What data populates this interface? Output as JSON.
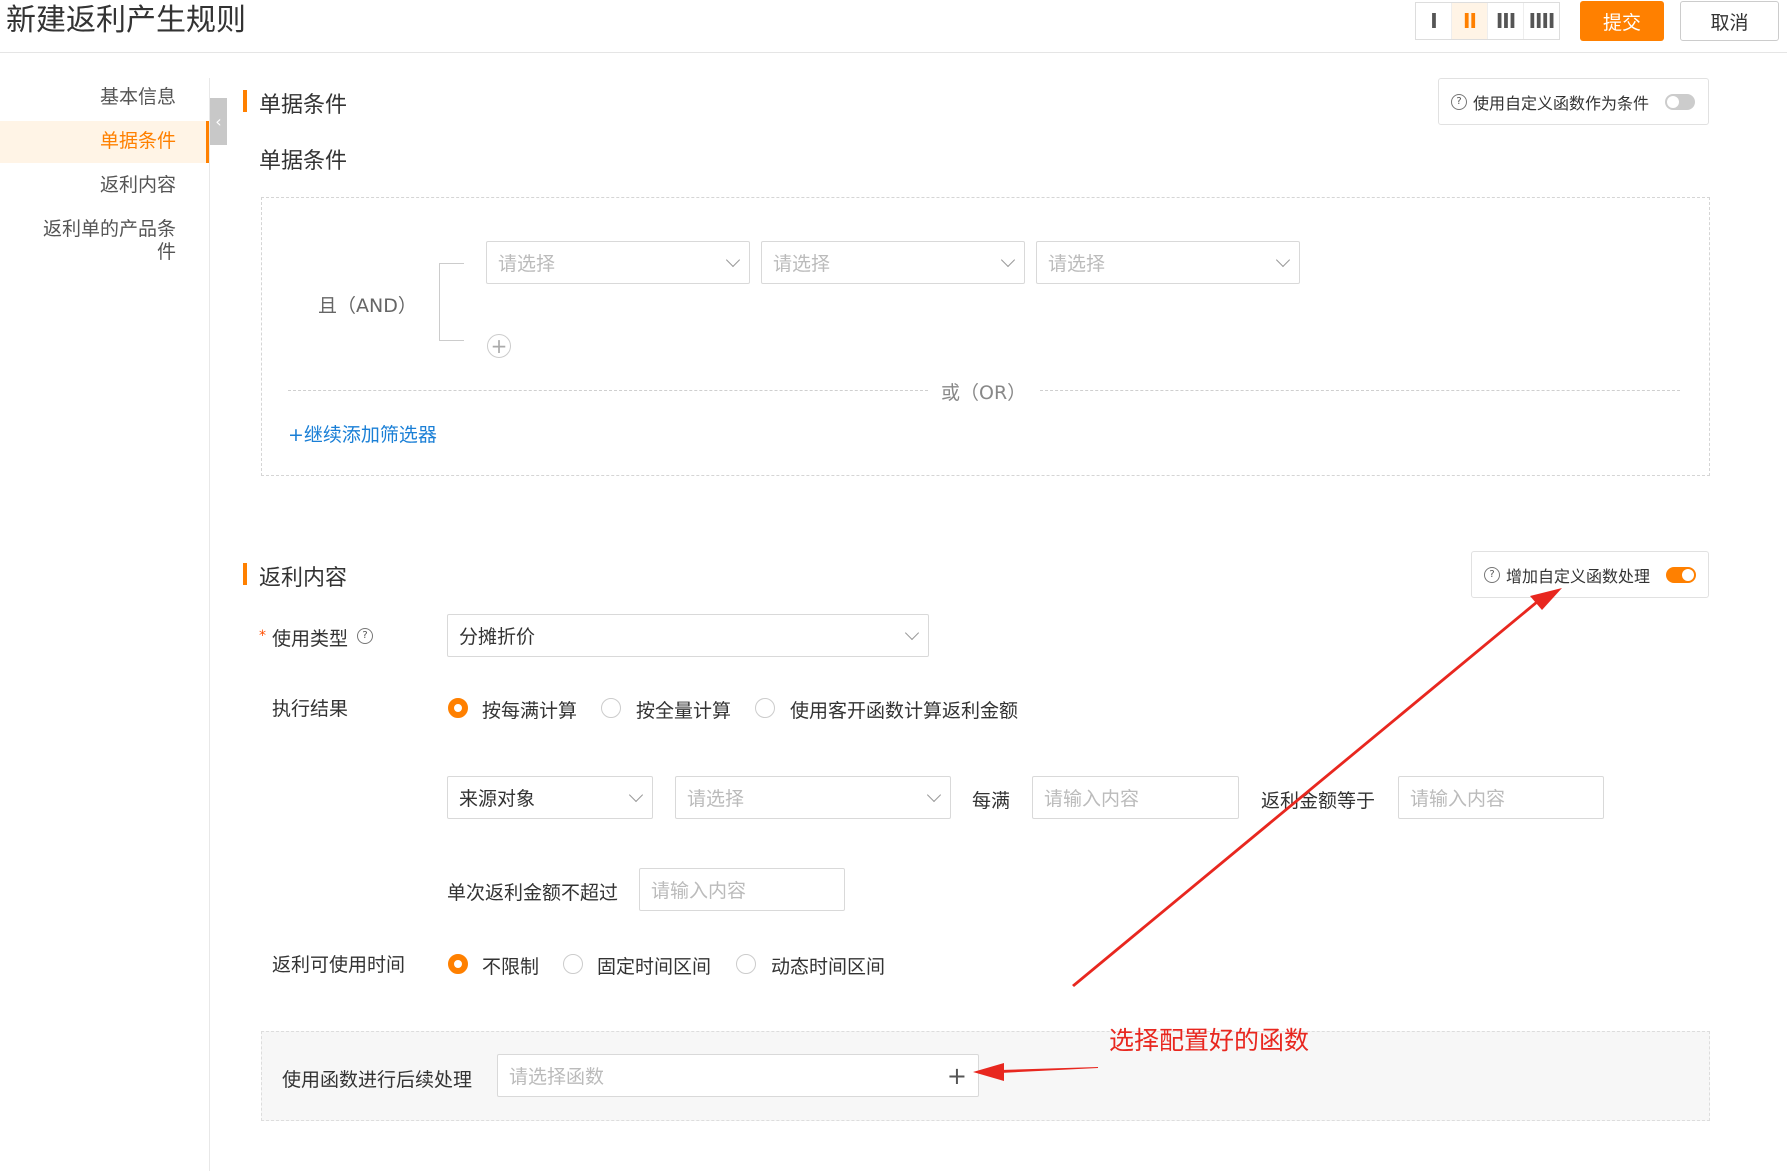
{
  "header": {
    "title": "新建返利产生规则",
    "layout_options": [
      "I",
      "II",
      "III",
      "IIII"
    ],
    "active_layout_index": 1,
    "submit_label": "提交",
    "cancel_label": "取消"
  },
  "sidebar": {
    "items": [
      {
        "label": "基本信息"
      },
      {
        "label": "单据条件"
      },
      {
        "label": "返利内容"
      },
      {
        "label": "返利单的产品条件"
      }
    ],
    "active_index": 1,
    "collapse_icon": "chevron-left-icon"
  },
  "doc_conditions": {
    "section_title": "单据条件",
    "subtitle": "单据条件",
    "custom_fn_toggle": {
      "label": "使用自定义函数作为条件",
      "on": false
    },
    "and_label": "且（AND）",
    "selects": [
      {
        "placeholder": "请选择"
      },
      {
        "placeholder": "请选择"
      },
      {
        "placeholder": "请选择"
      }
    ],
    "add_icon": "plus-circle-icon",
    "or_label": "或（OR）",
    "add_filter_label": "+继续添加筛选器"
  },
  "rebate_content": {
    "section_title": "返利内容",
    "custom_fn_toggle": {
      "label": "增加自定义函数处理",
      "on": true
    },
    "usage_type": {
      "label": "使用类型",
      "value": "分摊折价"
    },
    "exec_result": {
      "label": "执行结果",
      "options": [
        "按每满计算",
        "按全量计算",
        "使用客开函数计算返利金额"
      ],
      "selected_index": 0
    },
    "calc_row": {
      "source_select": "来源对象",
      "field_placeholder": "请选择",
      "each_full_label": "每满",
      "each_full_placeholder": "请输入内容",
      "amount_label": "返利金额等于",
      "amount_placeholder": "请输入内容"
    },
    "single_max": {
      "label": "单次返利金额不超过",
      "placeholder": "请输入内容"
    },
    "usable_time": {
      "label": "返利可使用时间",
      "options": [
        "不限制",
        "固定时间区间",
        "动态时间区间"
      ],
      "selected_index": 0
    },
    "post_process": {
      "label": "使用函数进行后续处理",
      "placeholder": "请选择函数",
      "add_symbol": "+"
    }
  },
  "annotation": {
    "text": "选择配置好的函数",
    "color": "#e8271f"
  },
  "colors": {
    "accent": "#ff8000",
    "link": "#1a7fd6"
  }
}
